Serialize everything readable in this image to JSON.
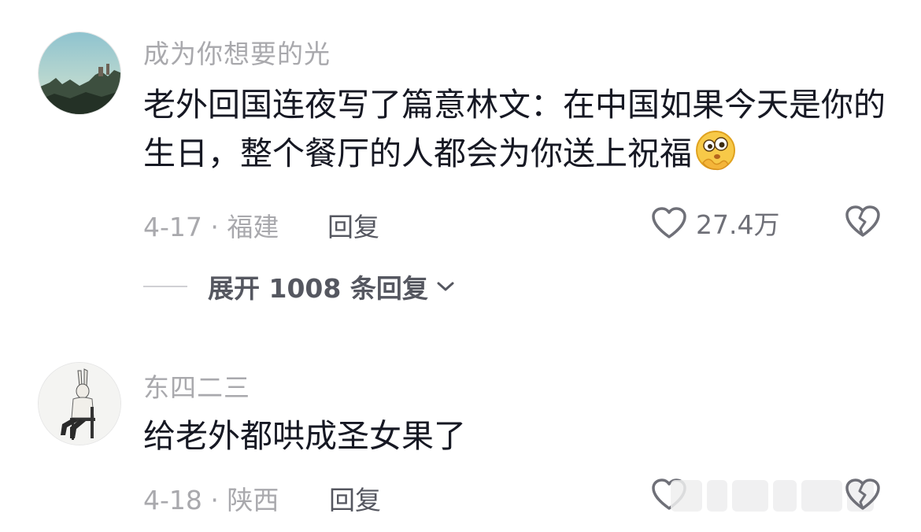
{
  "comments": [
    {
      "username": "成为你想要的光",
      "content": "老外回国连夜写了篇意林文：在中国如果今天是你的生日，整个餐厅的人都会为你送上祝福",
      "emoji": "shy-thinking-emoji",
      "date_location": "4-17 · 福建",
      "reply_label": "回复",
      "like_count": "27.4万",
      "expand_replies": "展开 1008 条回复"
    },
    {
      "username": "东四二三",
      "content": "给老外都哄成圣女果了",
      "date_location": "4-18 · 陕西",
      "reply_label": "回复"
    }
  ],
  "icons": {
    "like": "heart-outline-icon",
    "dislike": "broken-heart-icon",
    "expand": "chevron-down-icon"
  },
  "colors": {
    "text_primary": "#161823",
    "text_secondary": "#a9a9ad",
    "text_action": "#555760"
  }
}
